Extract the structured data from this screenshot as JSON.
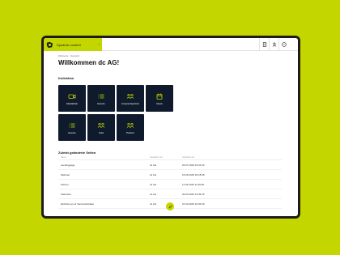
{
  "colors": {
    "background": "#c4d600",
    "accent": "#c4d600",
    "tile": "#0f1b2d"
  },
  "topbar": {
    "app_switch_label": "Dynamic content",
    "icons": [
      "building-icon",
      "user-icon",
      "help-icon"
    ]
  },
  "breadcrumb": "Webseite · Deutsch",
  "title": "Willkommen dc AG!",
  "collections": {
    "heading": "Kollektion",
    "tiles": [
      {
        "label": "Mediathek",
        "icon": "video-icon"
      },
      {
        "label": "Events",
        "icon": "list-icon"
      },
      {
        "label": "Ansprechpartner",
        "icon": "people-icon"
      },
      {
        "label": "News",
        "icon": "calendar-icon"
      },
      {
        "label": "Events",
        "icon": "list-icon"
      },
      {
        "label": "Jobs",
        "icon": "people-icon"
      },
      {
        "label": "Partner",
        "icon": "people-icon"
      }
    ]
  },
  "recent": {
    "heading": "Zuletzt geänderte Seiten",
    "columns": [
      "Name",
      "Geändert von",
      "Geändert am"
    ],
    "rows": [
      {
        "name": "Landingpage",
        "by": "dc AG",
        "at": "25.07.2025 15:33:43"
      },
      {
        "name": "Webinar",
        "by": "dc AG",
        "at": "15.05.2025 15:18:05"
      },
      {
        "name": "Partner",
        "by": "dc AG",
        "at": "11.04.2025 11:29:05"
      },
      {
        "name": "Startseite",
        "by": "dc AG",
        "at": "09.04.2025 13:39:15"
      },
      {
        "name": "Einführung zur Sammelinhaltet",
        "by": "dc AG",
        "at": "07.04.2025 16:35:39"
      }
    ]
  }
}
